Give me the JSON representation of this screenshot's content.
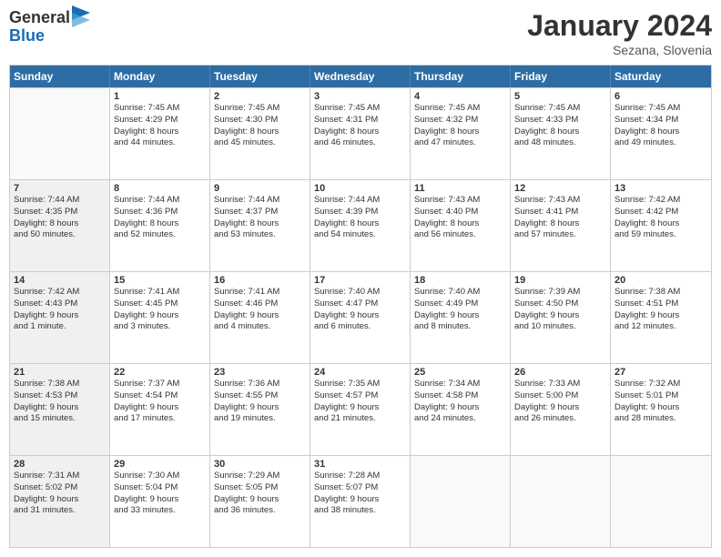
{
  "logo": {
    "general": "General",
    "blue": "Blue"
  },
  "title": {
    "month": "January 2024",
    "location": "Sezana, Slovenia"
  },
  "header_days": [
    "Sunday",
    "Monday",
    "Tuesday",
    "Wednesday",
    "Thursday",
    "Friday",
    "Saturday"
  ],
  "weeks": [
    [
      {
        "day": "",
        "lines": [],
        "empty": true
      },
      {
        "day": "1",
        "lines": [
          "Sunrise: 7:45 AM",
          "Sunset: 4:29 PM",
          "Daylight: 8 hours",
          "and 44 minutes."
        ]
      },
      {
        "day": "2",
        "lines": [
          "Sunrise: 7:45 AM",
          "Sunset: 4:30 PM",
          "Daylight: 8 hours",
          "and 45 minutes."
        ]
      },
      {
        "day": "3",
        "lines": [
          "Sunrise: 7:45 AM",
          "Sunset: 4:31 PM",
          "Daylight: 8 hours",
          "and 46 minutes."
        ]
      },
      {
        "day": "4",
        "lines": [
          "Sunrise: 7:45 AM",
          "Sunset: 4:32 PM",
          "Daylight: 8 hours",
          "and 47 minutes."
        ]
      },
      {
        "day": "5",
        "lines": [
          "Sunrise: 7:45 AM",
          "Sunset: 4:33 PM",
          "Daylight: 8 hours",
          "and 48 minutes."
        ]
      },
      {
        "day": "6",
        "lines": [
          "Sunrise: 7:45 AM",
          "Sunset: 4:34 PM",
          "Daylight: 8 hours",
          "and 49 minutes."
        ]
      }
    ],
    [
      {
        "day": "7",
        "lines": [
          "Sunrise: 7:44 AM",
          "Sunset: 4:35 PM",
          "Daylight: 8 hours",
          "and 50 minutes."
        ],
        "shaded": true
      },
      {
        "day": "8",
        "lines": [
          "Sunrise: 7:44 AM",
          "Sunset: 4:36 PM",
          "Daylight: 8 hours",
          "and 52 minutes."
        ]
      },
      {
        "day": "9",
        "lines": [
          "Sunrise: 7:44 AM",
          "Sunset: 4:37 PM",
          "Daylight: 8 hours",
          "and 53 minutes."
        ]
      },
      {
        "day": "10",
        "lines": [
          "Sunrise: 7:44 AM",
          "Sunset: 4:39 PM",
          "Daylight: 8 hours",
          "and 54 minutes."
        ]
      },
      {
        "day": "11",
        "lines": [
          "Sunrise: 7:43 AM",
          "Sunset: 4:40 PM",
          "Daylight: 8 hours",
          "and 56 minutes."
        ]
      },
      {
        "day": "12",
        "lines": [
          "Sunrise: 7:43 AM",
          "Sunset: 4:41 PM",
          "Daylight: 8 hours",
          "and 57 minutes."
        ]
      },
      {
        "day": "13",
        "lines": [
          "Sunrise: 7:42 AM",
          "Sunset: 4:42 PM",
          "Daylight: 8 hours",
          "and 59 minutes."
        ]
      }
    ],
    [
      {
        "day": "14",
        "lines": [
          "Sunrise: 7:42 AM",
          "Sunset: 4:43 PM",
          "Daylight: 9 hours",
          "and 1 minute."
        ],
        "shaded": true
      },
      {
        "day": "15",
        "lines": [
          "Sunrise: 7:41 AM",
          "Sunset: 4:45 PM",
          "Daylight: 9 hours",
          "and 3 minutes."
        ]
      },
      {
        "day": "16",
        "lines": [
          "Sunrise: 7:41 AM",
          "Sunset: 4:46 PM",
          "Daylight: 9 hours",
          "and 4 minutes."
        ]
      },
      {
        "day": "17",
        "lines": [
          "Sunrise: 7:40 AM",
          "Sunset: 4:47 PM",
          "Daylight: 9 hours",
          "and 6 minutes."
        ]
      },
      {
        "day": "18",
        "lines": [
          "Sunrise: 7:40 AM",
          "Sunset: 4:49 PM",
          "Daylight: 9 hours",
          "and 8 minutes."
        ]
      },
      {
        "day": "19",
        "lines": [
          "Sunrise: 7:39 AM",
          "Sunset: 4:50 PM",
          "Daylight: 9 hours",
          "and 10 minutes."
        ]
      },
      {
        "day": "20",
        "lines": [
          "Sunrise: 7:38 AM",
          "Sunset: 4:51 PM",
          "Daylight: 9 hours",
          "and 12 minutes."
        ]
      }
    ],
    [
      {
        "day": "21",
        "lines": [
          "Sunrise: 7:38 AM",
          "Sunset: 4:53 PM",
          "Daylight: 9 hours",
          "and 15 minutes."
        ],
        "shaded": true
      },
      {
        "day": "22",
        "lines": [
          "Sunrise: 7:37 AM",
          "Sunset: 4:54 PM",
          "Daylight: 9 hours",
          "and 17 minutes."
        ]
      },
      {
        "day": "23",
        "lines": [
          "Sunrise: 7:36 AM",
          "Sunset: 4:55 PM",
          "Daylight: 9 hours",
          "and 19 minutes."
        ]
      },
      {
        "day": "24",
        "lines": [
          "Sunrise: 7:35 AM",
          "Sunset: 4:57 PM",
          "Daylight: 9 hours",
          "and 21 minutes."
        ]
      },
      {
        "day": "25",
        "lines": [
          "Sunrise: 7:34 AM",
          "Sunset: 4:58 PM",
          "Daylight: 9 hours",
          "and 24 minutes."
        ]
      },
      {
        "day": "26",
        "lines": [
          "Sunrise: 7:33 AM",
          "Sunset: 5:00 PM",
          "Daylight: 9 hours",
          "and 26 minutes."
        ]
      },
      {
        "day": "27",
        "lines": [
          "Sunrise: 7:32 AM",
          "Sunset: 5:01 PM",
          "Daylight: 9 hours",
          "and 28 minutes."
        ]
      }
    ],
    [
      {
        "day": "28",
        "lines": [
          "Sunrise: 7:31 AM",
          "Sunset: 5:02 PM",
          "Daylight: 9 hours",
          "and 31 minutes."
        ],
        "shaded": true
      },
      {
        "day": "29",
        "lines": [
          "Sunrise: 7:30 AM",
          "Sunset: 5:04 PM",
          "Daylight: 9 hours",
          "and 33 minutes."
        ]
      },
      {
        "day": "30",
        "lines": [
          "Sunrise: 7:29 AM",
          "Sunset: 5:05 PM",
          "Daylight: 9 hours",
          "and 36 minutes."
        ]
      },
      {
        "day": "31",
        "lines": [
          "Sunrise: 7:28 AM",
          "Sunset: 5:07 PM",
          "Daylight: 9 hours",
          "and 38 minutes."
        ]
      },
      {
        "day": "",
        "lines": [],
        "empty": true
      },
      {
        "day": "",
        "lines": [],
        "empty": true
      },
      {
        "day": "",
        "lines": [],
        "empty": true
      }
    ]
  ]
}
